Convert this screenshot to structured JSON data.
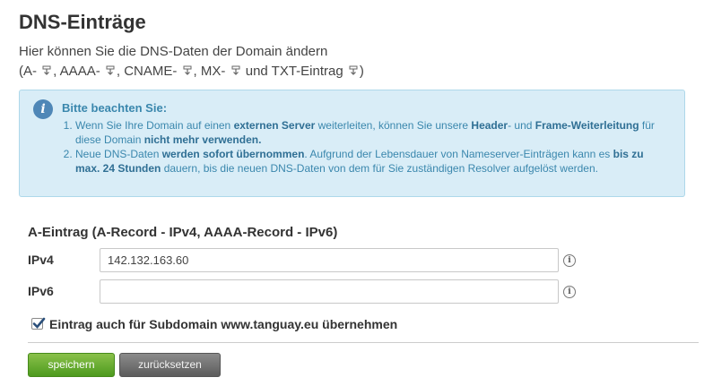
{
  "header": {
    "title": "DNS-Einträge",
    "description": "Hier können Sie die DNS-Daten der Domain ändern",
    "record_links": [
      {
        "label": "(A-"
      },
      {
        "label": ", AAAA-"
      },
      {
        "label": ", CNAME-"
      },
      {
        "label": ", MX-"
      },
      {
        "label": "und TXT-Eintrag"
      }
    ],
    "closing_paren": ")"
  },
  "notice": {
    "title": "Bitte beachten Sie:",
    "item1": {
      "t1": "Wenn Sie Ihre Domain auf einen ",
      "b1": "externen Server",
      "t2": " weiterleiten, können Sie unsere ",
      "b2": "Header",
      "t3": "- und ",
      "b3": "Frame-Weiterleitung",
      "t4": " für diese Domain ",
      "b4": "nicht mehr verwenden.",
      "t5": ""
    },
    "item2": {
      "t1": "Neue DNS-Daten ",
      "b1": "werden sofort übernommen",
      "t2": ". Aufgrund der Lebensdauer von Nameserver-Einträgen kann es ",
      "b2": "bis zu max. 24 Stunden",
      "t3": " dauern, bis die neuen DNS-Daten von dem für Sie zuständigen Resolver aufgelöst werden."
    }
  },
  "form": {
    "section_title": "A-Eintrag (A-Record - IPv4, AAAA-Record - IPv6)",
    "ipv4_label": "IPv4",
    "ipv4_value": "142.132.163.60",
    "ipv6_label": "IPv6",
    "ipv6_value": "",
    "help_glyph": "i",
    "subdomain_checked": true,
    "subdomain_label": "Eintrag auch für Subdomain www.tanguay.eu übernehmen"
  },
  "buttons": {
    "save_label": "speichern",
    "reset_label": "zurücksetzen"
  },
  "icons": {
    "record_link_icon": "download-arrow-icon",
    "notice_icon": "info-icon",
    "help_icon": "info-circle-icon"
  },
  "colors": {
    "notice_bg": "#d9edf7",
    "notice_text": "#3a87ad",
    "save_button": "#5ea82a",
    "reset_button": "#707070"
  }
}
